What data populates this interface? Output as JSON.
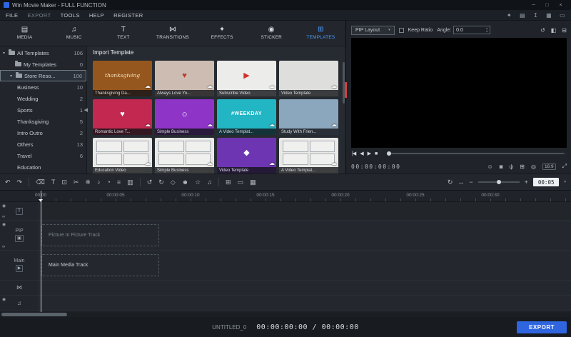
{
  "titlebar": {
    "title": "Win Movie Maker - FULL FUNCTION",
    "controls": [
      {
        "name": "minimize",
        "glyph": "─"
      },
      {
        "name": "maximize",
        "glyph": "□"
      },
      {
        "name": "close",
        "glyph": "×"
      }
    ]
  },
  "menubar": {
    "items": [
      "FILE",
      "EXPORT",
      "TOOLS",
      "HELP",
      "REGISTER"
    ],
    "right_icons": [
      {
        "name": "wand-icon",
        "glyph": "✦"
      },
      {
        "name": "clapper-icon",
        "glyph": "▤"
      },
      {
        "name": "upload-icon",
        "glyph": "↥"
      },
      {
        "name": "cart-icon",
        "glyph": "▦"
      },
      {
        "name": "display-icon",
        "glyph": "▭"
      }
    ]
  },
  "tabs": [
    {
      "label": "MEDIA",
      "glyph": "▤"
    },
    {
      "label": "MUSIC",
      "glyph": "♫"
    },
    {
      "label": "TEXT",
      "glyph": "T"
    },
    {
      "label": "TRANSITIONS",
      "glyph": "⋈"
    },
    {
      "label": "EFFECTS",
      "glyph": "✦"
    },
    {
      "label": "STICKER",
      "glyph": "◉"
    },
    {
      "label": "TEMPLATES",
      "glyph": "⊞"
    }
  ],
  "sidebar": {
    "collapse_glyph": "◀",
    "items": [
      {
        "label": "All Templates",
        "count": "106",
        "caret": "▾",
        "selected": false
      },
      {
        "label": "My Templates",
        "count": "0",
        "caret": "",
        "selected": false
      },
      {
        "label": "Store Reso...",
        "count": "106",
        "caret": "▾",
        "selected": true
      },
      {
        "label": "Business",
        "count": "10"
      },
      {
        "label": "Wedding",
        "count": "2"
      },
      {
        "label": "Sports",
        "count": "1"
      },
      {
        "label": "Thanksgiving",
        "count": "5"
      },
      {
        "label": "Intro Outro",
        "count": "2"
      },
      {
        "label": "Others",
        "count": "13"
      },
      {
        "label": "Travel",
        "count": "6"
      },
      {
        "label": "Education",
        "count": ""
      }
    ]
  },
  "templates": {
    "header": "Import Template",
    "download_glyph": "☁",
    "items": [
      {
        "title": "Thanksgiving Da...",
        "bg": "#96571e",
        "decor": "thanksgiving",
        "decor_color": "#f5e3c0"
      },
      {
        "title": "Always Love Yo...",
        "bg": "#cdbcb2",
        "decor": "♥",
        "decor_color": "#c0392b"
      },
      {
        "title": "Subscribe Video",
        "bg": "#ececea",
        "decor": "▶",
        "decor_color": "#d03030"
      },
      {
        "title": "Video Template",
        "bg": "#dededc",
        "decor": "",
        "decor_color": "#888888"
      },
      {
        "title": "Romantic Love T...",
        "bg": "#c22850",
        "decor": "♥",
        "decor_color": "#ffffff"
      },
      {
        "title": "Simple Business",
        "bg": "#8e35c8",
        "decor": "○",
        "decor_color": "#ffffff"
      },
      {
        "title": "A Video Templat...",
        "bg": "#22b5c4",
        "decor": "#WEEKDAY",
        "decor_color": "#ffffff"
      },
      {
        "title": "Study With Frien...",
        "bg": "#8aa7bd",
        "decor": "",
        "decor_color": "#ffffff"
      },
      {
        "title": "Education Video",
        "bg": "#e8e8e6",
        "decor": "",
        "decor_color": "#888888"
      },
      {
        "title": "Simple Business",
        "bg": "#e8e8e6",
        "decor": "",
        "decor_color": "#888888"
      },
      {
        "title": "Video Template",
        "bg": "#6d35b2",
        "decor": "◆",
        "decor_color": "#ffffff"
      },
      {
        "title": "A Video Templat...",
        "bg": "#e8e8e6",
        "decor": "",
        "decor_color": "#888888"
      }
    ]
  },
  "preview": {
    "pip_layout": "PIP Layout",
    "pip_caret": "▾",
    "keep_ratio": "Keep Ratio",
    "angle_label": "Angle:",
    "angle_value": "0.0",
    "spin_up": "▴",
    "spin_down": "▾",
    "tool_icons": [
      {
        "name": "rotate-icon",
        "glyph": "↺"
      },
      {
        "name": "flip-horizontal-icon",
        "glyph": "◧"
      },
      {
        "name": "flip-vertical-icon",
        "glyph": "⊟"
      }
    ],
    "transport": [
      {
        "name": "skip-start-button",
        "glyph": "|◀"
      },
      {
        "name": "step-back-button",
        "glyph": "◀"
      },
      {
        "name": "play-button",
        "glyph": "▶"
      },
      {
        "name": "stop-button",
        "glyph": "■"
      }
    ],
    "timecode": "00:00:00:00",
    "bottom_icons": [
      {
        "name": "face-icon",
        "glyph": "☺"
      },
      {
        "name": "camera-icon",
        "glyph": "◙"
      },
      {
        "name": "mic-icon",
        "glyph": "ψ"
      },
      {
        "name": "grid-icon",
        "glyph": "⊞"
      },
      {
        "name": "snapshot-icon",
        "glyph": "◎"
      }
    ],
    "aspect_ratio": "16:9",
    "expand_glyph": "⤢"
  },
  "timeline_toolbar": {
    "left_icons": [
      {
        "name": "undo-icon",
        "glyph": "↶"
      },
      {
        "name": "redo-icon",
        "glyph": "↷"
      },
      {
        "name": "divider",
        "glyph": ""
      },
      {
        "name": "delete-icon",
        "glyph": "⌫"
      },
      {
        "name": "text-tool-icon",
        "glyph": "T"
      },
      {
        "name": "crop-icon",
        "glyph": "⊡"
      },
      {
        "name": "split-icon",
        "glyph": "✂"
      },
      {
        "name": "freeze-icon",
        "glyph": "❄"
      },
      {
        "name": "mute-icon",
        "glyph": "♪"
      },
      {
        "name": "speed-icon",
        "glyph": "◔"
      },
      {
        "name": "equalizer-icon",
        "glyph": "≡"
      },
      {
        "name": "chart-icon",
        "glyph": "▥"
      },
      {
        "name": "divider",
        "glyph": ""
      },
      {
        "name": "rotate-ccw-icon",
        "glyph": "↺"
      },
      {
        "name": "rotate-cw-icon",
        "glyph": "↻"
      },
      {
        "name": "marker-icon",
        "glyph": "◇"
      },
      {
        "name": "avatar-icon",
        "glyph": "☻"
      },
      {
        "name": "star-icon",
        "glyph": "☆"
      },
      {
        "name": "audio-mix-icon",
        "glyph": "♫"
      },
      {
        "name": "divider",
        "glyph": ""
      },
      {
        "name": "crop-frame-icon",
        "glyph": "⊞"
      },
      {
        "name": "screen-icon",
        "glyph": "▭"
      },
      {
        "name": "grid2-icon",
        "glyph": "▦"
      }
    ],
    "right": {
      "render_glyph": "↻",
      "fit_glyph": "↔",
      "zoom_out": "−",
      "zoom_in": "+",
      "duration": "00:05",
      "caret": "▾"
    }
  },
  "ruler": {
    "labels": [
      "00:00",
      "00:00:05",
      "00:00:10",
      "00:00:15",
      "00:00:20",
      "00:00:25",
      "00:00:30"
    ]
  },
  "tracks": {
    "eye_glyph": "◉",
    "link_glyph": "∞",
    "text": {
      "glyph": "T"
    },
    "pip": {
      "label": "PIP",
      "glyph": "▣",
      "placeholder": "Picture In Picture Track"
    },
    "main": {
      "label": "Main",
      "glyph": "▶",
      "placeholder": "Main Media Track"
    },
    "transition": {
      "glyph": "⋈"
    },
    "audio": {
      "glyph": "♫"
    }
  },
  "statusbar": {
    "project": "UNTITLED_0",
    "timecode": "00:00:00:00 / 00:00:00",
    "export": "EXPORT"
  }
}
